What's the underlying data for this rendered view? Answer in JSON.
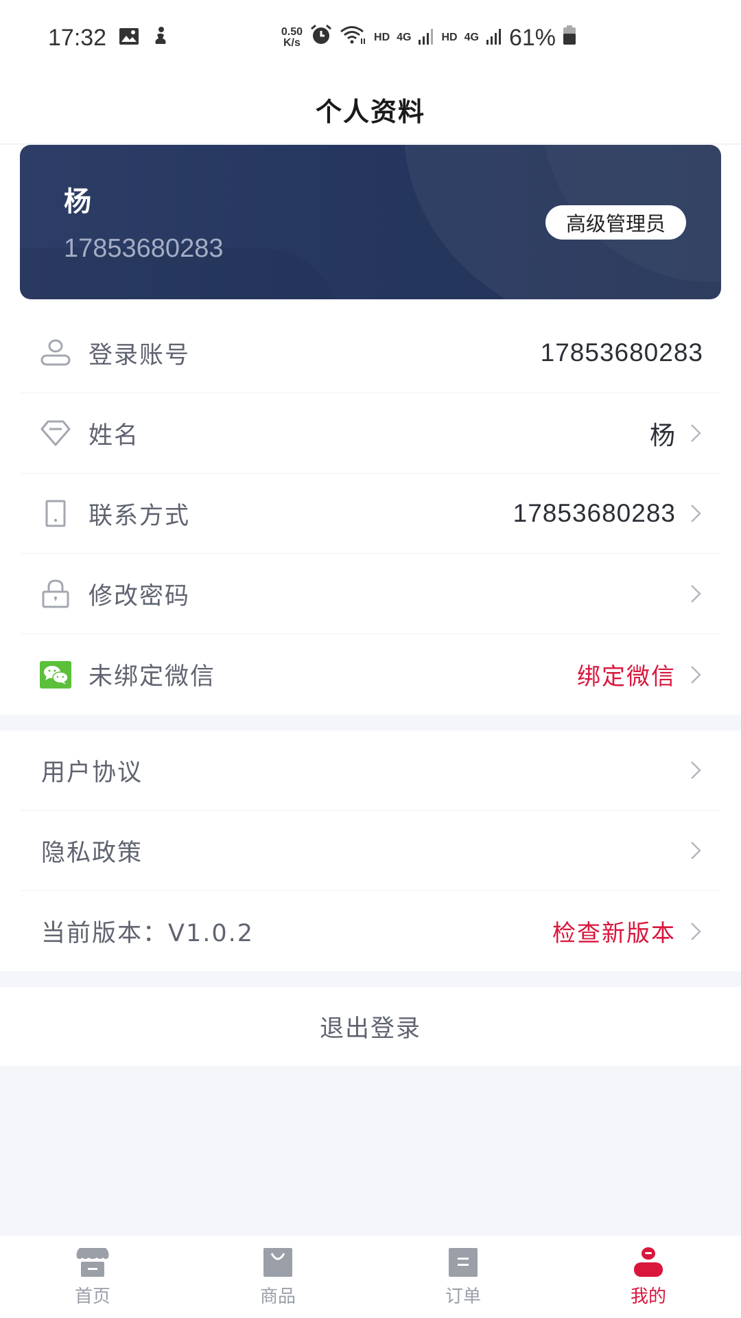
{
  "status_bar": {
    "time": "17:32",
    "net_speed_value": "0.50",
    "net_speed_unit": "K/s",
    "hd1": "HD",
    "net1": "4G",
    "hd2": "HD",
    "net2": "4G",
    "battery": "61%"
  },
  "header": {
    "title": "个人资料"
  },
  "profile": {
    "name": "杨",
    "phone": "17853680283",
    "role": "高级管理员"
  },
  "account_items": [
    {
      "icon": "user-icon",
      "label": "登录账号",
      "value": "17853680283",
      "chevron": false
    },
    {
      "icon": "diamond-icon",
      "label": "姓名",
      "value": "杨",
      "chevron": true
    },
    {
      "icon": "phone-icon",
      "label": "联系方式",
      "value": "17853680283",
      "chevron": true
    },
    {
      "icon": "lock-icon",
      "label": "修改密码",
      "value": "",
      "chevron": true
    },
    {
      "icon": "wechat-icon",
      "label": "未绑定微信",
      "value": "绑定微信",
      "chevron": true,
      "value_color": "#d9163c"
    }
  ],
  "info_items": [
    {
      "label": "用户协议",
      "value": ""
    },
    {
      "label": "隐私政策",
      "value": ""
    },
    {
      "label": "当前版本：V1.0.2",
      "value": "检查新版本",
      "value_color": "#d9163c"
    }
  ],
  "logout_label": "退出登录",
  "tabs": [
    {
      "label": "首页",
      "icon": "store-icon",
      "active": false
    },
    {
      "label": "商品",
      "icon": "bag-icon",
      "active": false
    },
    {
      "label": "订单",
      "icon": "order-icon",
      "active": false
    },
    {
      "label": "我的",
      "icon": "profile-icon",
      "active": true
    }
  ],
  "colors": {
    "accent": "#d9163c",
    "card_bg": "#263760",
    "icon_gray": "#9a9fa8",
    "wechat_green": "#5bbf3a"
  }
}
